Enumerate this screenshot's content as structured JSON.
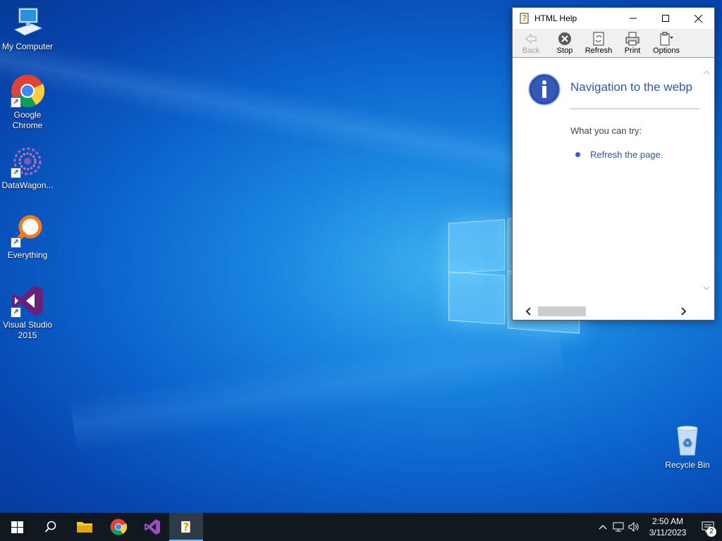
{
  "desktop": {
    "icons": [
      {
        "label": "My Computer"
      },
      {
        "label": "Google Chrome"
      },
      {
        "label": "DataWagon..."
      },
      {
        "label": "Everything"
      },
      {
        "label": "Visual Studio 2015"
      },
      {
        "label": "Recycle Bin"
      }
    ]
  },
  "window": {
    "title": "HTML Help",
    "toolbar": {
      "back": "Back",
      "stop": "Stop",
      "refresh": "Refresh",
      "print": "Print",
      "options": "Options"
    },
    "content": {
      "heading": "Navigation to the webp",
      "try_text": "What you can try:",
      "refresh_link": "Refresh the page."
    }
  },
  "taskbar": {
    "time": "2:50 AM",
    "date": "3/11/2023",
    "notification_count": "2"
  },
  "colors": {
    "accent": "#2a5aa8",
    "taskbar": "#101820",
    "desktop_blue": "#0c63cd"
  }
}
